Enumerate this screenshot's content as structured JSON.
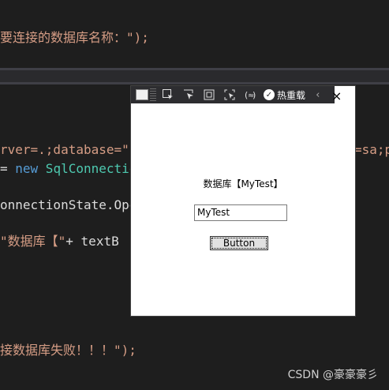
{
  "code": {
    "line1": "要连接的数据库名称：\");",
    "line2_a": "rver=.;database=\"",
    "line2_b": "=sa;p",
    "line3_a": "= ",
    "line3_kw": "new",
    "line3_type": " SqlConnectio",
    "line4": "onnectionState.Ope",
    "line5_str": "\"数据库【\"",
    "line5_plain": "+ textB",
    "line6": "接数据库失败！！！\");"
  },
  "toolbar": {
    "hot_reload_label": "热重载"
  },
  "form": {
    "label_text": "数据库【MyTest】",
    "textbox_value": "MyTest",
    "button_label": "Button"
  },
  "watermark": "CSDN @豪豪豪彡",
  "colors": {
    "editor_bg": "#1e1e1e",
    "string": "#d69d85",
    "keyword": "#569cd6",
    "type": "#4ec9b0"
  }
}
